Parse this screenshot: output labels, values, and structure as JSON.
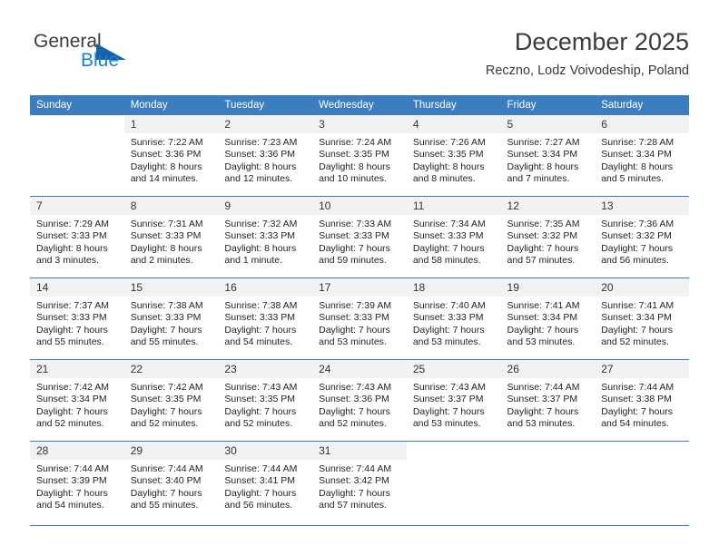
{
  "brand": {
    "name_top": "General",
    "name_bottom": "Blue",
    "triangle_color": "#1464aa",
    "blue_color": "#1c7fd0"
  },
  "header": {
    "title": "December 2025",
    "subtitle": "Reczno, Lodz Voivodeship, Poland"
  },
  "theme": {
    "header_bg": "#3b7ebf",
    "header_text": "#ffffff",
    "daynum_bg": "#f2f2f2",
    "row_divider": "#3b7ebf"
  },
  "weekday_headers": [
    "Sunday",
    "Monday",
    "Tuesday",
    "Wednesday",
    "Thursday",
    "Friday",
    "Saturday"
  ],
  "weeks": [
    [
      {
        "day": "",
        "blank": true,
        "lines": []
      },
      {
        "day": "1",
        "lines": [
          "Sunrise: 7:22 AM",
          "Sunset: 3:36 PM",
          "Daylight: 8 hours",
          "and 14 minutes."
        ]
      },
      {
        "day": "2",
        "lines": [
          "Sunrise: 7:23 AM",
          "Sunset: 3:36 PM",
          "Daylight: 8 hours",
          "and 12 minutes."
        ]
      },
      {
        "day": "3",
        "lines": [
          "Sunrise: 7:24 AM",
          "Sunset: 3:35 PM",
          "Daylight: 8 hours",
          "and 10 minutes."
        ]
      },
      {
        "day": "4",
        "lines": [
          "Sunrise: 7:26 AM",
          "Sunset: 3:35 PM",
          "Daylight: 8 hours",
          "and 8 minutes."
        ]
      },
      {
        "day": "5",
        "lines": [
          "Sunrise: 7:27 AM",
          "Sunset: 3:34 PM",
          "Daylight: 8 hours",
          "and 7 minutes."
        ]
      },
      {
        "day": "6",
        "lines": [
          "Sunrise: 7:28 AM",
          "Sunset: 3:34 PM",
          "Daylight: 8 hours",
          "and 5 minutes."
        ]
      }
    ],
    [
      {
        "day": "7",
        "lines": [
          "Sunrise: 7:29 AM",
          "Sunset: 3:33 PM",
          "Daylight: 8 hours",
          "and 3 minutes."
        ]
      },
      {
        "day": "8",
        "lines": [
          "Sunrise: 7:31 AM",
          "Sunset: 3:33 PM",
          "Daylight: 8 hours",
          "and 2 minutes."
        ]
      },
      {
        "day": "9",
        "lines": [
          "Sunrise: 7:32 AM",
          "Sunset: 3:33 PM",
          "Daylight: 8 hours",
          "and 1 minute."
        ]
      },
      {
        "day": "10",
        "lines": [
          "Sunrise: 7:33 AM",
          "Sunset: 3:33 PM",
          "Daylight: 7 hours",
          "and 59 minutes."
        ]
      },
      {
        "day": "11",
        "lines": [
          "Sunrise: 7:34 AM",
          "Sunset: 3:33 PM",
          "Daylight: 7 hours",
          "and 58 minutes."
        ]
      },
      {
        "day": "12",
        "lines": [
          "Sunrise: 7:35 AM",
          "Sunset: 3:32 PM",
          "Daylight: 7 hours",
          "and 57 minutes."
        ]
      },
      {
        "day": "13",
        "lines": [
          "Sunrise: 7:36 AM",
          "Sunset: 3:32 PM",
          "Daylight: 7 hours",
          "and 56 minutes."
        ]
      }
    ],
    [
      {
        "day": "14",
        "lines": [
          "Sunrise: 7:37 AM",
          "Sunset: 3:33 PM",
          "Daylight: 7 hours",
          "and 55 minutes."
        ]
      },
      {
        "day": "15",
        "lines": [
          "Sunrise: 7:38 AM",
          "Sunset: 3:33 PM",
          "Daylight: 7 hours",
          "and 55 minutes."
        ]
      },
      {
        "day": "16",
        "lines": [
          "Sunrise: 7:38 AM",
          "Sunset: 3:33 PM",
          "Daylight: 7 hours",
          "and 54 minutes."
        ]
      },
      {
        "day": "17",
        "lines": [
          "Sunrise: 7:39 AM",
          "Sunset: 3:33 PM",
          "Daylight: 7 hours",
          "and 53 minutes."
        ]
      },
      {
        "day": "18",
        "lines": [
          "Sunrise: 7:40 AM",
          "Sunset: 3:33 PM",
          "Daylight: 7 hours",
          "and 53 minutes."
        ]
      },
      {
        "day": "19",
        "lines": [
          "Sunrise: 7:41 AM",
          "Sunset: 3:34 PM",
          "Daylight: 7 hours",
          "and 53 minutes."
        ]
      },
      {
        "day": "20",
        "lines": [
          "Sunrise: 7:41 AM",
          "Sunset: 3:34 PM",
          "Daylight: 7 hours",
          "and 52 minutes."
        ]
      }
    ],
    [
      {
        "day": "21",
        "lines": [
          "Sunrise: 7:42 AM",
          "Sunset: 3:34 PM",
          "Daylight: 7 hours",
          "and 52 minutes."
        ]
      },
      {
        "day": "22",
        "lines": [
          "Sunrise: 7:42 AM",
          "Sunset: 3:35 PM",
          "Daylight: 7 hours",
          "and 52 minutes."
        ]
      },
      {
        "day": "23",
        "lines": [
          "Sunrise: 7:43 AM",
          "Sunset: 3:35 PM",
          "Daylight: 7 hours",
          "and 52 minutes."
        ]
      },
      {
        "day": "24",
        "lines": [
          "Sunrise: 7:43 AM",
          "Sunset: 3:36 PM",
          "Daylight: 7 hours",
          "and 52 minutes."
        ]
      },
      {
        "day": "25",
        "lines": [
          "Sunrise: 7:43 AM",
          "Sunset: 3:37 PM",
          "Daylight: 7 hours",
          "and 53 minutes."
        ]
      },
      {
        "day": "26",
        "lines": [
          "Sunrise: 7:44 AM",
          "Sunset: 3:37 PM",
          "Daylight: 7 hours",
          "and 53 minutes."
        ]
      },
      {
        "day": "27",
        "lines": [
          "Sunrise: 7:44 AM",
          "Sunset: 3:38 PM",
          "Daylight: 7 hours",
          "and 54 minutes."
        ]
      }
    ],
    [
      {
        "day": "28",
        "lines": [
          "Sunrise: 7:44 AM",
          "Sunset: 3:39 PM",
          "Daylight: 7 hours",
          "and 54 minutes."
        ]
      },
      {
        "day": "29",
        "lines": [
          "Sunrise: 7:44 AM",
          "Sunset: 3:40 PM",
          "Daylight: 7 hours",
          "and 55 minutes."
        ]
      },
      {
        "day": "30",
        "lines": [
          "Sunrise: 7:44 AM",
          "Sunset: 3:41 PM",
          "Daylight: 7 hours",
          "and 56 minutes."
        ]
      },
      {
        "day": "31",
        "lines": [
          "Sunrise: 7:44 AM",
          "Sunset: 3:42 PM",
          "Daylight: 7 hours",
          "and 57 minutes."
        ]
      },
      {
        "day": "",
        "blank": true,
        "lines": []
      },
      {
        "day": "",
        "blank": true,
        "lines": []
      },
      {
        "day": "",
        "blank": true,
        "lines": []
      }
    ]
  ]
}
